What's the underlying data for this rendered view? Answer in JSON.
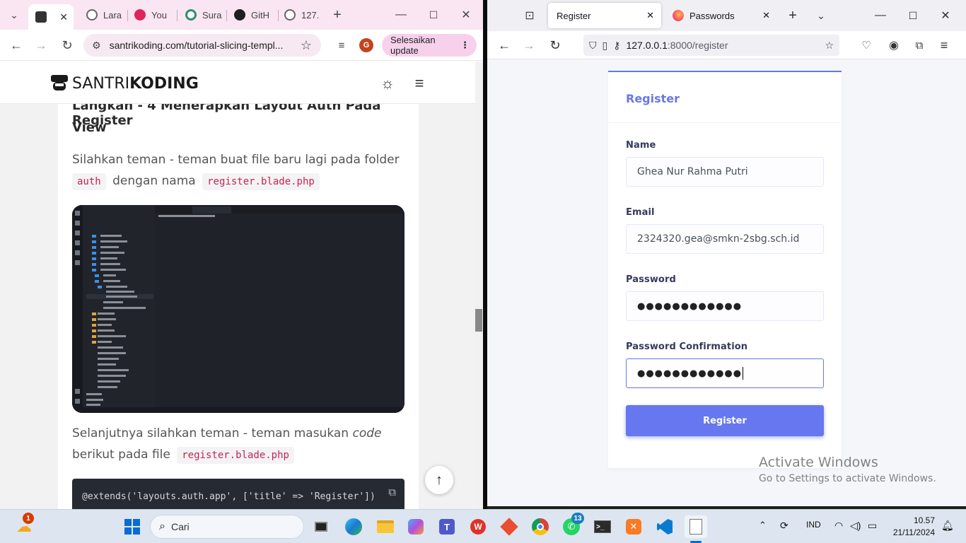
{
  "chrome": {
    "tabs": [
      {
        "label": "",
        "active": true
      },
      {
        "label": "Lara"
      },
      {
        "label": "You"
      },
      {
        "label": "Sura"
      },
      {
        "label": "GitH"
      },
      {
        "label": "127."
      }
    ],
    "url": "santrikoding.com/tutorial-slicing-templ...",
    "update_label": "Selesaikan update",
    "profile_initial": "G"
  },
  "article": {
    "logo_light": "SANTRI",
    "logo_bold": "KODING",
    "heading_line1": "Langkah - 4 Menerapkan Layout Auth Pada Register",
    "heading_line2": "View",
    "para1_line1": "Silahkan teman - teman buat file baru lagi pada folder",
    "para1_code1": "auth",
    "para1_mid": "dengan nama",
    "para1_code2": "register.blade.php",
    "para2_pre": "Selanjutnya silahkan teman - teman masukan ",
    "para2_em": "code",
    "para2_line2": "berikut pada file",
    "para2_code": "register.blade.php",
    "code_line": "@extends('layouts.auth.app', ['title' => 'Register'])"
  },
  "firefox": {
    "tabs": [
      {
        "label": "Register",
        "active": true
      },
      {
        "label": "Passwords"
      }
    ],
    "url_host": "127.0.0.1",
    "url_rest": ":8000/register"
  },
  "register_form": {
    "title": "Register",
    "name_label": "Name",
    "name_value": "Ghea Nur Rahma Putri",
    "email_label": "Email",
    "email_value": "2324320.gea@smkn-2sbg.sch.id",
    "password_label": "Password",
    "password_value": "●●●●●●●●●●●●",
    "confirm_label": "Password Confirmation",
    "confirm_value": "●●●●●●●●●●●●",
    "submit_label": "Register"
  },
  "watermark": {
    "line1": "Activate Windows",
    "line2": "Go to Settings to activate Windows."
  },
  "taskbar": {
    "search_placeholder": "Cari",
    "weather_badge": "1",
    "whatsapp_badge": "13",
    "language": "IND",
    "time": "10.57",
    "date": "21/11/2024"
  },
  "colors": {
    "primary": "#6777ef",
    "chrome_tab_bg": "#f9e6f2",
    "update_bg": "#f7d1ec"
  }
}
